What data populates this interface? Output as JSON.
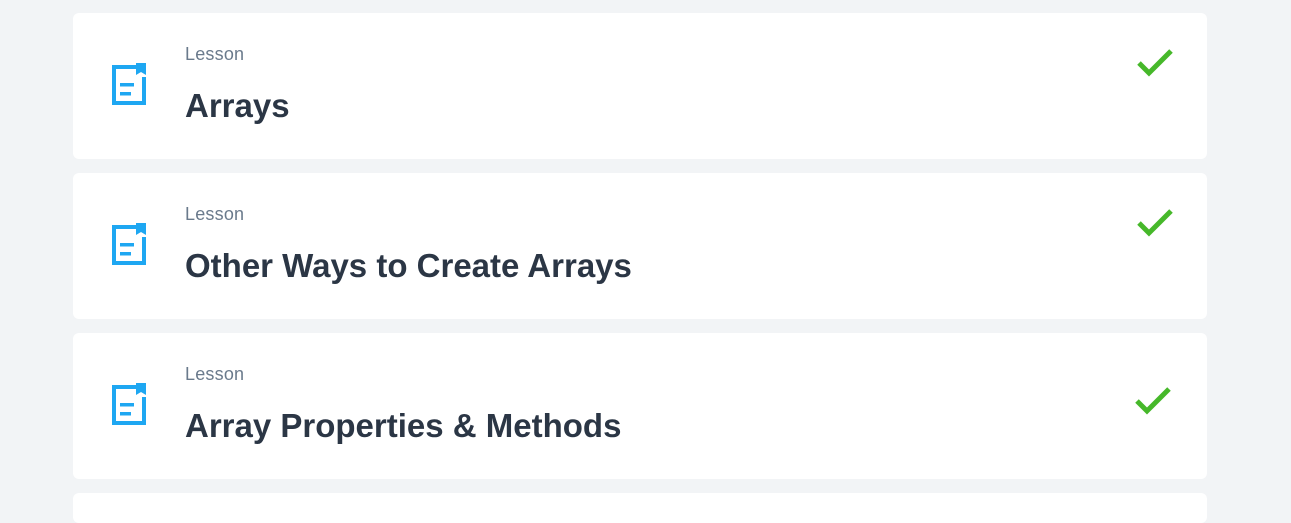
{
  "lessons": [
    {
      "kind": "Lesson",
      "title": "Arrays",
      "completed": true,
      "icon": "document-icon",
      "status_icon": "checkmark-icon"
    },
    {
      "kind": "Lesson",
      "title": "Other Ways to Create Arrays",
      "completed": true,
      "icon": "document-icon",
      "status_icon": "checkmark-icon"
    },
    {
      "kind": "Lesson",
      "title": "Array Properties & Methods",
      "completed": true,
      "icon": "document-icon",
      "status_icon": "checkmark-icon"
    }
  ],
  "colors": {
    "background": "#f2f4f6",
    "card": "#ffffff",
    "icon_blue": "#1ea7f2",
    "check_green": "#46b82a",
    "title_text": "#2b3645",
    "kind_text": "#6a7a8c"
  }
}
